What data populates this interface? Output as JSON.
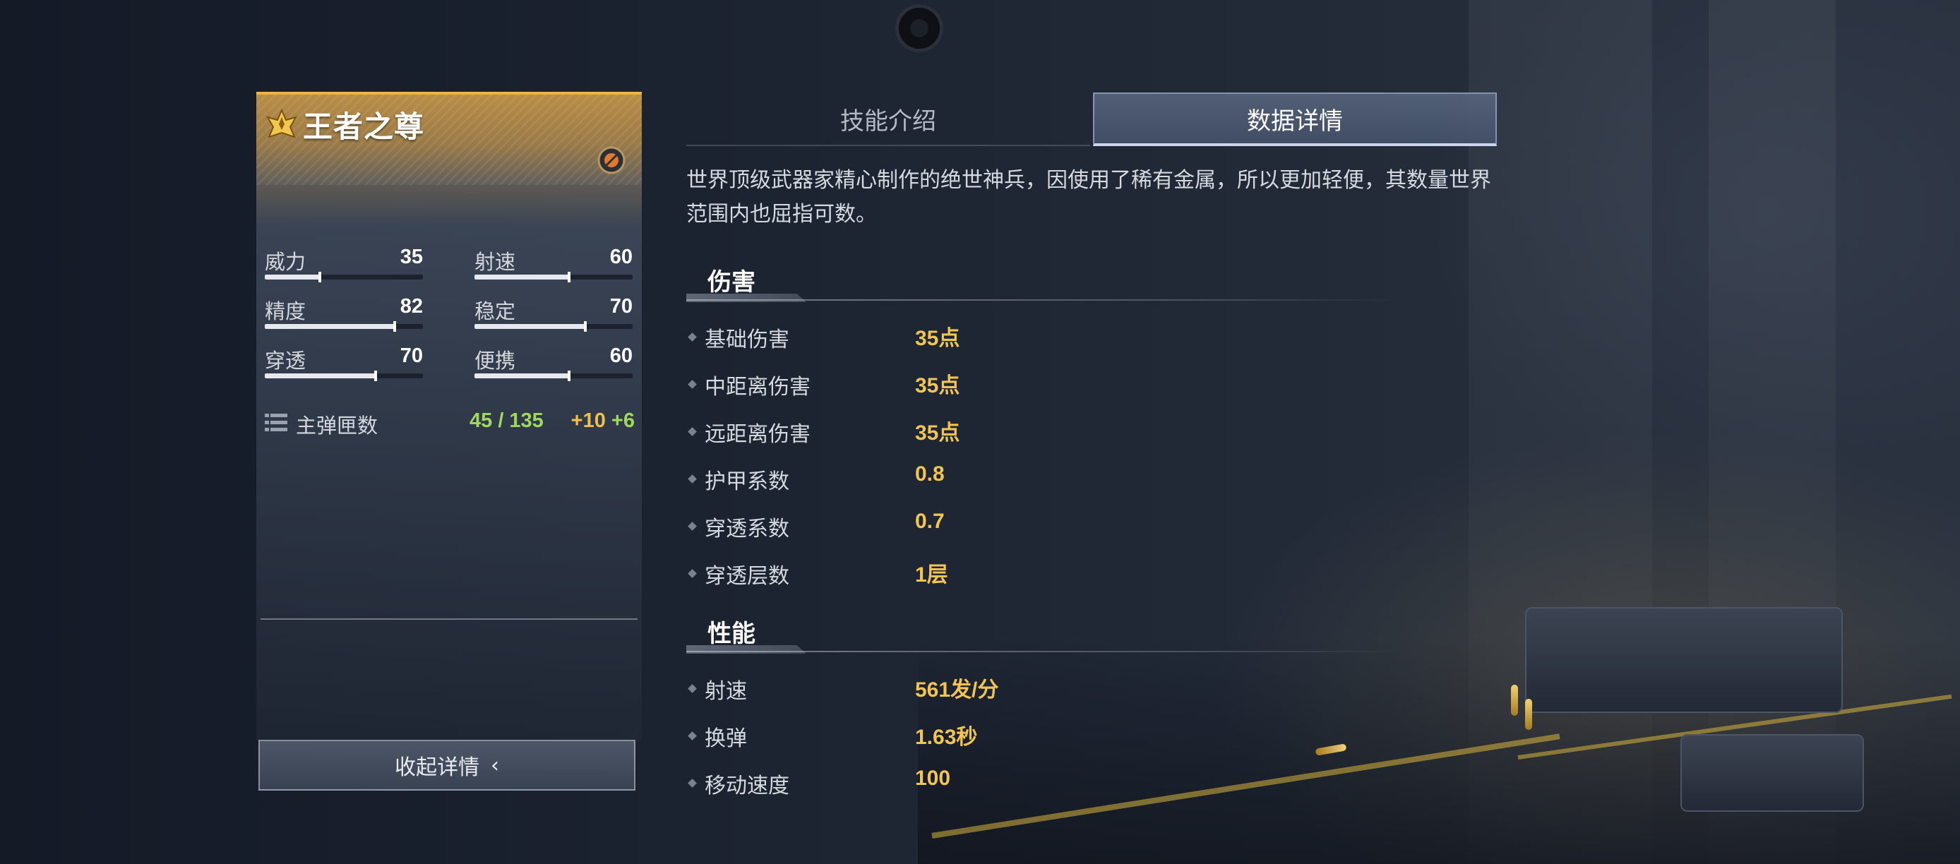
{
  "weapon": {
    "name": "王者之尊",
    "tier_icon": "crown-emblem-icon",
    "badge_icon": "weapon-badge-icon",
    "accent_color": "#e9b545",
    "stats": [
      {
        "label": "威力",
        "value": "35",
        "level": 0.35
      },
      {
        "label": "射速",
        "value": "60",
        "level": 0.6
      },
      {
        "label": "精度",
        "value": "82",
        "level": 0.82
      },
      {
        "label": "稳定",
        "value": "70",
        "level": 0.7
      },
      {
        "label": "穿透",
        "value": "70",
        "level": 0.7
      },
      {
        "label": "便携",
        "value": "60",
        "level": 0.6
      }
    ],
    "ammo": {
      "icon": "magazine-icon",
      "label": "主弹匣数",
      "count": "45 / 135",
      "bonus_primary": "+10",
      "bonus_secondary": "+6",
      "count_color": "#9fd95b",
      "bonus_color": "#f0c04b"
    },
    "collapse_label": "收起详情",
    "collapse_icon": "chevron-left-icon"
  },
  "tabs": [
    {
      "label": "技能介绍",
      "active": false
    },
    {
      "label": "数据详情",
      "active": true
    }
  ],
  "description": "世界顶级武器家精心制作的绝世神兵，因使用了稀有金属，所以更加轻便，其数量世界范围内也屈指可数。",
  "sections": [
    {
      "title": "伤害",
      "rows": [
        {
          "label": "基础伤害",
          "value": "35点"
        },
        {
          "label": "中距离伤害",
          "value": "35点"
        },
        {
          "label": "远距离伤害",
          "value": "35点"
        },
        {
          "label": "护甲系数",
          "value": "0.8"
        },
        {
          "label": "穿透系数",
          "value": "0.7"
        },
        {
          "label": "穿透层数",
          "value": "1层"
        }
      ]
    },
    {
      "title": "性能",
      "rows": [
        {
          "label": "射速",
          "value": "561发/分"
        },
        {
          "label": "换弹",
          "value": "1.63秒"
        },
        {
          "label": "移动速度",
          "value": "100"
        }
      ]
    }
  ],
  "value_color": "#f2c453"
}
